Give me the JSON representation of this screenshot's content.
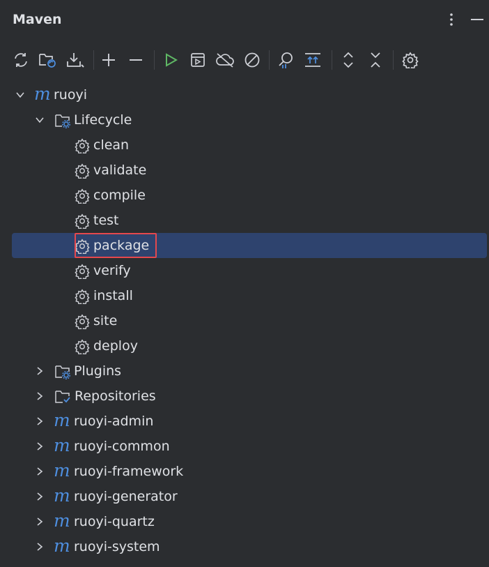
{
  "panel": {
    "title": "Maven"
  },
  "header_icons": [
    "more-vertical-icon",
    "minimize-icon"
  ],
  "toolbar": {
    "buttons": [
      "reload-all-projects-icon",
      "generate-sources-icon",
      "download-sources-icon",
      "add-project-icon",
      "remove-project-icon",
      "run-icon",
      "execute-goal-icon",
      "offline-mode-icon",
      "skip-tests-icon",
      "show-dependencies-icon",
      "collapse-expand-icon",
      "expand-all-icon",
      "collapse-all-icon",
      "settings-icon"
    ]
  },
  "tree": {
    "root": {
      "label": "ruoyi",
      "icon": "maven-module-icon"
    },
    "lifecycle": {
      "label": "Lifecycle"
    },
    "goals": [
      "clean",
      "validate",
      "compile",
      "test",
      "package",
      "verify",
      "install",
      "site",
      "deploy"
    ],
    "selected_goal": "package",
    "plugins": {
      "label": "Plugins"
    },
    "repositories": {
      "label": "Repositories"
    },
    "modules": [
      "ruoyi-admin",
      "ruoyi-common",
      "ruoyi-framework",
      "ruoyi-generator",
      "ruoyi-quartz",
      "ruoyi-system"
    ]
  },
  "colors": {
    "background": "#2b2d30",
    "selection": "#2e436e",
    "highlight_border": "#e5484d",
    "maven_blue": "#4e8fe0",
    "run_green": "#5fb865"
  }
}
